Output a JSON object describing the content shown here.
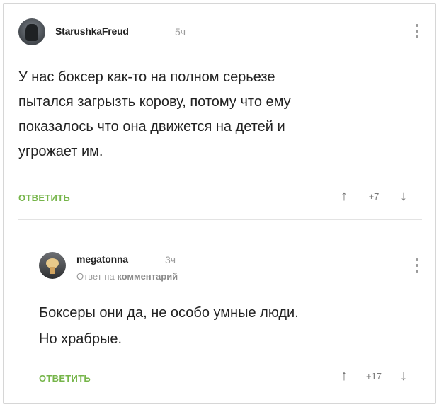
{
  "comment": {
    "username": "StarushkaFreud",
    "time": "5ч",
    "text": "У нас боксер как-то на полном серьезе\nпытался загрызть корову,  потому что ему\nпоказалось что она движется на детей и\nугрожает им.",
    "reply_label": "ОТВЕТИТЬ",
    "score": "+7",
    "upvote": "↑",
    "downvote": "↓"
  },
  "reply": {
    "username": "megatonna",
    "time": "3ч",
    "subtitle_prefix": "Ответ на",
    "subtitle_link": "комментарий",
    "text": "Боксеры они да, не особо умные люди.\nНо храбрые.",
    "reply_label": "ОТВЕТИТЬ",
    "score": "+17",
    "upvote": "↑",
    "downvote": "↓"
  }
}
